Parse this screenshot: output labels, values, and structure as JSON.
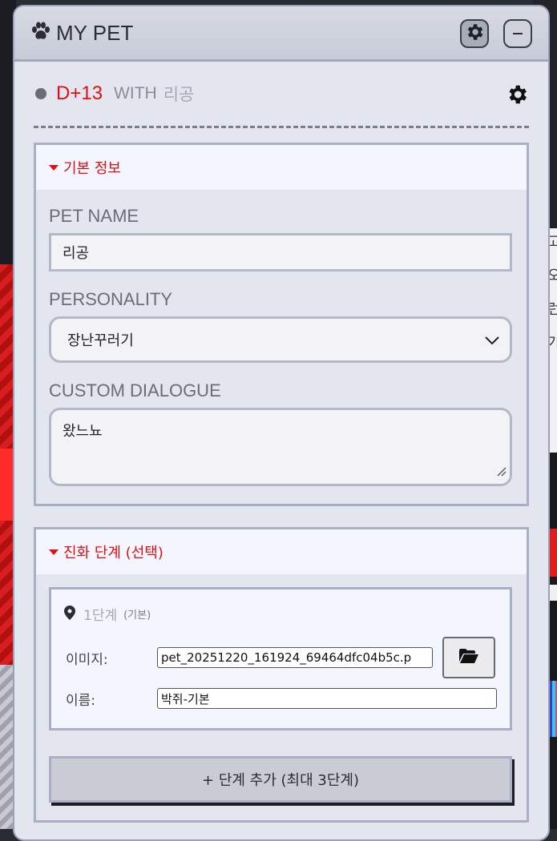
{
  "window": {
    "title": "MY PET"
  },
  "status": {
    "dday": "D+13",
    "with_label": "WITH",
    "pet_name": "리공"
  },
  "basic_info": {
    "header": "기본 정보",
    "pet_name_label": "PET NAME",
    "pet_name_value": "리공",
    "personality_label": "PERSONALITY",
    "personality_value": "장난꾸러기",
    "dialogue_label": "CUSTOM DIALOGUE",
    "dialogue_value": "왔느뇨"
  },
  "evolution": {
    "header": "진화 단계 (선택)",
    "stages": [
      {
        "name": "1단계",
        "tag": "(기본)",
        "image_label": "이미지:",
        "image_value": "pet_20251220_161924_69464dfc04b5c.p",
        "name_label": "이름:",
        "name_value": "박쥐-기본"
      }
    ],
    "add_button": "+ 단계 추가 (최대 3단계)"
  },
  "edge_glyphs": [
    "고",
    "오",
    "런",
    "가"
  ],
  "colors": {
    "accent": "#e01010",
    "border": "#a8afc6",
    "panel": "#e3e6ef",
    "header_bg": "#f3f6ff"
  },
  "icons": [
    "paw-icon",
    "gear-icon",
    "minimize-icon",
    "status-dot-icon",
    "caret-down-icon",
    "chevron-down-icon",
    "map-pin-icon",
    "folder-open-icon",
    "resize-grip-icon"
  ]
}
